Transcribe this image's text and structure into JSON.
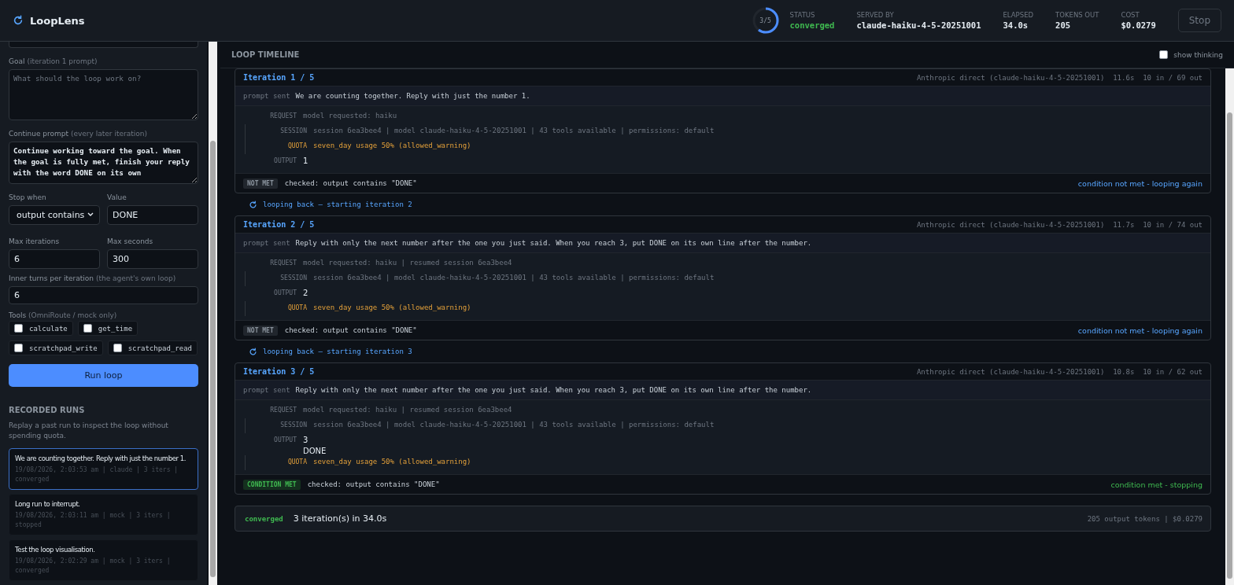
{
  "app": {
    "title": "LoopLens"
  },
  "header": {
    "progress": {
      "label": "3/5",
      "level": 0.6
    },
    "stats": [
      {
        "label": "STATUS",
        "value": "converged",
        "kind": "status"
      },
      {
        "label": "SERVED BY",
        "value": "claude-haiku-4-5-20251001",
        "kind": "plain"
      },
      {
        "label": "ELAPSED",
        "value": "34.0s",
        "kind": "plain"
      },
      {
        "label": "TOKENS OUT",
        "value": "205",
        "kind": "plain"
      },
      {
        "label": "COST",
        "value": "$0.0279",
        "kind": "plain"
      }
    ],
    "stop_button": {
      "label": "Stop",
      "disabled": true
    }
  },
  "sidebar": {
    "goal": {
      "label": "Goal",
      "hint": "(iteration 1 prompt)",
      "placeholder": "What should the loop work on?"
    },
    "continue": {
      "label": "Continue prompt",
      "hint": "(every later iteration)",
      "value": "Continue working toward the goal. When the goal is fully met, finish your reply with the word DONE on its own"
    },
    "stop_when": {
      "label": "Stop when",
      "value": "output contains"
    },
    "value": {
      "label": "Value",
      "value": "DONE"
    },
    "max_iterations": {
      "label": "Max iterations",
      "value": "6"
    },
    "max_seconds": {
      "label": "Max seconds",
      "value": "300"
    },
    "inner_turns": {
      "label": "Inner turns per iteration",
      "hint": "(the agent's own loop)",
      "value": "6"
    },
    "tools": {
      "label": "Tools",
      "hint": "(OmniRoute / mock only)",
      "items": [
        {
          "name": "calculate",
          "checked": false
        },
        {
          "name": "get_time",
          "checked": false
        },
        {
          "name": "scratchpad_write",
          "checked": false
        },
        {
          "name": "scratchpad_read",
          "checked": false
        }
      ]
    },
    "run_button": "Run loop",
    "recorded_runs": {
      "title": "RECORDED RUNS",
      "description": "Replay a past run to inspect the loop without spending quota.",
      "items": [
        {
          "title": "We are counting together. Reply with just the number 1.",
          "meta": "19/08/2026, 2:03:53 am | claude | 3 iters | converged",
          "selected": true
        },
        {
          "title": "Long run to interrupt.",
          "meta": "19/08/2026, 2:03:11 am | mock | 3 iters | stopped",
          "selected": false
        },
        {
          "title": "Test the loop visualisation.",
          "meta": "19/08/2026, 2:02:29 am | mock | 3 iters | converged",
          "selected": false
        }
      ]
    }
  },
  "timeline": {
    "title": "LOOP TIMELINE",
    "show_thinking": {
      "label": "show thinking",
      "checked": false
    },
    "iterations": [
      {
        "title": "Iteration 1 / 5",
        "meta": "Anthropic direct (claude-haiku-4-5-20251001)  11.6s  10 in / 69 out",
        "prompt_label": "prompt sent",
        "prompt": "We are counting together. Reply with just the number 1.",
        "events": [
          {
            "kind": "request",
            "label": "REQUEST",
            "lines": [
              "model requested: haiku"
            ],
            "nested": false
          },
          {
            "kind": "session",
            "label": "SESSION",
            "lines": [
              "session 6ea3bee4 | model claude-haiku-4-5-20251001 | 43 tools available | permissions: default"
            ],
            "nested": true
          },
          {
            "kind": "quota",
            "label": "QUOTA",
            "lines": [
              "seven_day usage 50% (allowed_warning)"
            ],
            "nested": true
          },
          {
            "kind": "output",
            "label": "OUTPUT",
            "lines": [
              "1"
            ],
            "nested": false
          }
        ],
        "condition": {
          "met": false,
          "badge": "NOT MET",
          "check": "checked: output contains \"DONE\"",
          "result": "condition not met - looping again"
        },
        "loop_back": "looping back — starting iteration 2"
      },
      {
        "title": "Iteration 2 / 5",
        "meta": "Anthropic direct (claude-haiku-4-5-20251001)  11.7s  10 in / 74 out",
        "prompt_label": "prompt sent",
        "prompt": "Reply with only the next number after the one you just said. When you reach 3, put DONE on its own line after the number.",
        "events": [
          {
            "kind": "request",
            "label": "REQUEST",
            "lines": [
              "model requested: haiku | resumed session 6ea3bee4"
            ],
            "nested": false
          },
          {
            "kind": "session",
            "label": "SESSION",
            "lines": [
              "session 6ea3bee4 | model claude-haiku-4-5-20251001 | 43 tools available | permissions: default"
            ],
            "nested": true
          },
          {
            "kind": "output",
            "label": "OUTPUT",
            "lines": [
              "2"
            ],
            "nested": false
          },
          {
            "kind": "quota",
            "label": "QUOTA",
            "lines": [
              "seven_day usage 50% (allowed_warning)"
            ],
            "nested": true
          }
        ],
        "condition": {
          "met": false,
          "badge": "NOT MET",
          "check": "checked: output contains \"DONE\"",
          "result": "condition not met - looping again"
        },
        "loop_back": "looping back — starting iteration 3"
      },
      {
        "title": "Iteration 3 / 5",
        "meta": "Anthropic direct (claude-haiku-4-5-20251001)  10.8s  10 in / 62 out",
        "prompt_label": "prompt sent",
        "prompt": "Reply with only the next number after the one you just said. When you reach 3, put DONE on its own line after the number.",
        "events": [
          {
            "kind": "request",
            "label": "REQUEST",
            "lines": [
              "model requested: haiku | resumed session 6ea3bee4"
            ],
            "nested": false
          },
          {
            "kind": "session",
            "label": "SESSION",
            "lines": [
              "session 6ea3bee4 | model claude-haiku-4-5-20251001 | 43 tools available | permissions: default"
            ],
            "nested": true
          },
          {
            "kind": "output",
            "label": "OUTPUT",
            "lines": [
              "3",
              "DONE"
            ],
            "nested": false
          },
          {
            "kind": "quota",
            "label": "QUOTA",
            "lines": [
              "seven_day usage 50% (allowed_warning)"
            ],
            "nested": true
          }
        ],
        "condition": {
          "met": true,
          "badge": "CONDITION MET",
          "check": "checked: output contains \"DONE\"",
          "result": "condition met - stopping"
        }
      }
    ],
    "summary": {
      "status": "converged",
      "text": "3 iteration(s) in 34.0s",
      "meta": "205 output tokens | $0.0279"
    }
  }
}
